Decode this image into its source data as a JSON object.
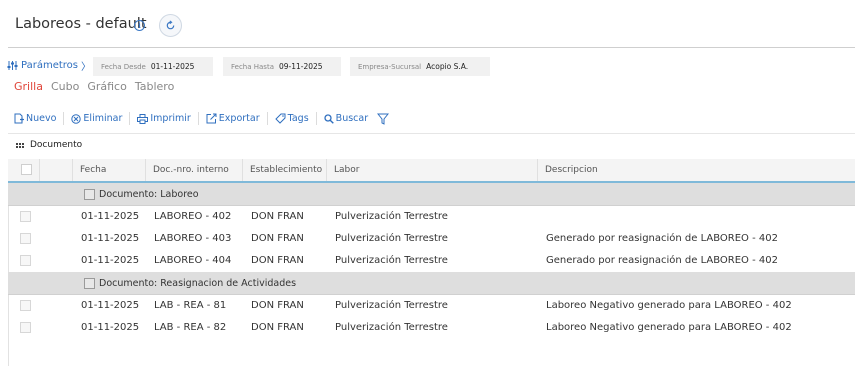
{
  "header": {
    "title": "Laboreos - default"
  },
  "params": {
    "link_label": "Parámetros",
    "filters": [
      {
        "label": "Fecha Desde",
        "value": "01-11-2025"
      },
      {
        "label": "Fecha Hasta",
        "value": "09-11-2025"
      },
      {
        "label": "Empresa-Sucursal",
        "value": "Acopio S.A."
      }
    ]
  },
  "views": {
    "grilla": "Grilla",
    "cubo": "Cubo",
    "grafico": "Gráfico",
    "tablero": "Tablero",
    "active": "Grilla"
  },
  "toolbar": {
    "nuevo": "Nuevo",
    "eliminar": "Eliminar",
    "imprimir": "Imprimir",
    "exportar": "Exportar",
    "tags": "Tags",
    "buscar": "Buscar"
  },
  "group_panel": {
    "label": "Documento"
  },
  "grid": {
    "columns": [
      "Fecha",
      "Doc.-nro. interno",
      "Establecimiento",
      "Labor",
      "Descripcion"
    ],
    "groups": [
      {
        "label": "Documento: Laboreo",
        "rows": [
          [
            "01-11-2025",
            "LABOREO - 402",
            "DON FRAN",
            "Pulverización Terrestre",
            ""
          ],
          [
            "01-11-2025",
            "LABOREO - 403",
            "DON FRAN",
            "Pulverización Terrestre",
            "Generado por reasignación de LABOREO - 402"
          ],
          [
            "01-11-2025",
            "LABOREO - 404",
            "DON FRAN",
            "Pulverización Terrestre",
            "Generado por reasignación de LABOREO - 402"
          ]
        ]
      },
      {
        "label": "Documento: Reasignacion de Actividades",
        "rows": [
          [
            "01-11-2025",
            "LAB - REA - 81",
            "DON FRAN",
            "Pulverización Terrestre",
            "Laboreo Negativo generado para LABOREO - 402"
          ],
          [
            "01-11-2025",
            "LAB - REA - 82",
            "DON FRAN",
            "Pulverización Terrestre",
            "Laboreo Negativo generado para LABOREO - 402"
          ]
        ]
      }
    ]
  }
}
